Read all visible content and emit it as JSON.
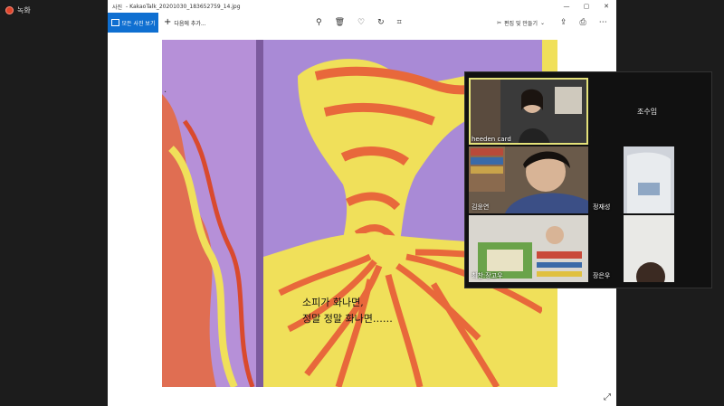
{
  "recording": {
    "label": "녹화"
  },
  "window": {
    "app_name": "사진",
    "title": "- KakaoTalk_20201030_183652759_14.jpg",
    "controls": [
      "—",
      "▢",
      "✕"
    ]
  },
  "toolbar": {
    "all_photos_label": "모든 사진 보기",
    "add_label": "다음에 추가...",
    "edit_label": "편집 및 만들기"
  },
  "book": {
    "text_line1": "소피가 화나면,",
    "text_line2": "정말 정말 화나면……",
    "marker": ".",
    "colors": {
      "purple": "#a98ad6",
      "yellow": "#f0e05a",
      "orange": "#e8683b",
      "red": "#d94a2e"
    }
  },
  "video_call": {
    "participants": [
      {
        "name": "heeden card",
        "active": true
      },
      {
        "name": "조수임"
      },
      {
        "name": "김윤연"
      },
      {
        "name": "정재성"
      },
      {
        "name": "최찬:장고우"
      },
      {
        "name": "장은우"
      }
    ]
  }
}
